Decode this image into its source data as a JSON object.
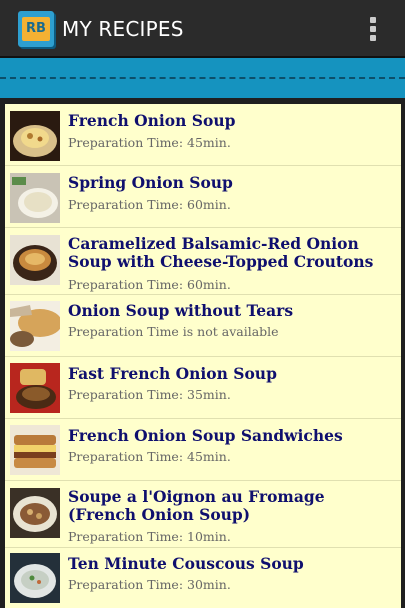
{
  "app": {
    "title": "MY RECIPES",
    "icon_label": "RB",
    "icon": "app-book-icon",
    "overflow_icon": "overflow-menu-icon"
  },
  "colors": {
    "action_bar": "#2b2b2b",
    "banner": "#1593bf",
    "list_background": "#ffffcc",
    "title_text": "#0f0f6e",
    "prep_text": "#666666"
  },
  "recipes": [
    {
      "title": "French Onion Soup",
      "prep": "Preparation Time: 45min."
    },
    {
      "title": "Spring Onion Soup",
      "prep": "Preparation Time: 60min."
    },
    {
      "title": "Caramelized Balsamic-Red Onion Soup with Cheese-Topped Croutons",
      "prep": "Preparation Time: 60min."
    },
    {
      "title": "Onion Soup without Tears",
      "prep": "Preparation Time is not available"
    },
    {
      "title": "Fast French Onion Soup",
      "prep": "Preparation Time: 35min."
    },
    {
      "title": "French Onion Soup Sandwiches",
      "prep": "Preparation Time: 45min."
    },
    {
      "title": "Soupe a l'Oignon au Fromage (French Onion Soup)",
      "prep": "Preparation Time: 10min."
    },
    {
      "title": "Ten Minute Couscous Soup",
      "prep": "Preparation Time: 30min."
    }
  ]
}
